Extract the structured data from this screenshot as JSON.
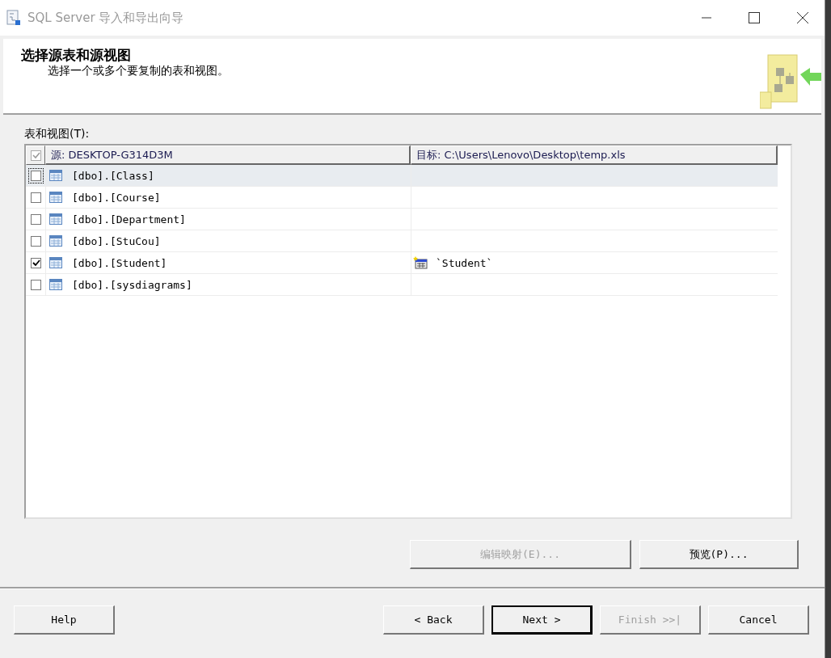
{
  "window": {
    "title": "SQL Server 导入和导出向导"
  },
  "header": {
    "title": "选择源表和源视图",
    "subtitle": "选择一个或多个要复制的表和视图。"
  },
  "grid_label": "表和视图(T):",
  "table": {
    "all_checked": true,
    "columns": [
      "源: DESKTOP-G314D3M",
      "目标: C:\\Users\\Lenovo\\Desktop\\temp.xls"
    ],
    "rows": [
      {
        "checked": false,
        "selected": true,
        "source": "[dbo].[Class]"
      },
      {
        "checked": false,
        "selected": false,
        "source": "[dbo].[Course]"
      },
      {
        "checked": false,
        "selected": false,
        "source": "[dbo].[Department]"
      },
      {
        "checked": false,
        "selected": false,
        "source": "[dbo].[StuCou]"
      },
      {
        "checked": true,
        "selected": false,
        "source": "[dbo].[Student]",
        "destination": "`Student`"
      },
      {
        "checked": false,
        "selected": false,
        "source": "[dbo].[sysdiagrams]"
      }
    ]
  },
  "actions": [
    {
      "label": "编辑映射(E)...",
      "disabled": true
    },
    {
      "label": "预览(P)...",
      "disabled": false
    }
  ],
  "nav_buttons": [
    {
      "label": "Help",
      "disabled": false,
      "default": false
    },
    {
      "label": "< Back",
      "disabled": false,
      "default": false
    },
    {
      "label": "Next >",
      "disabled": false,
      "default": true
    },
    {
      "label": "Finish >>|",
      "disabled": true,
      "default": false
    },
    {
      "label": "Cancel",
      "disabled": false,
      "default": false
    }
  ]
}
